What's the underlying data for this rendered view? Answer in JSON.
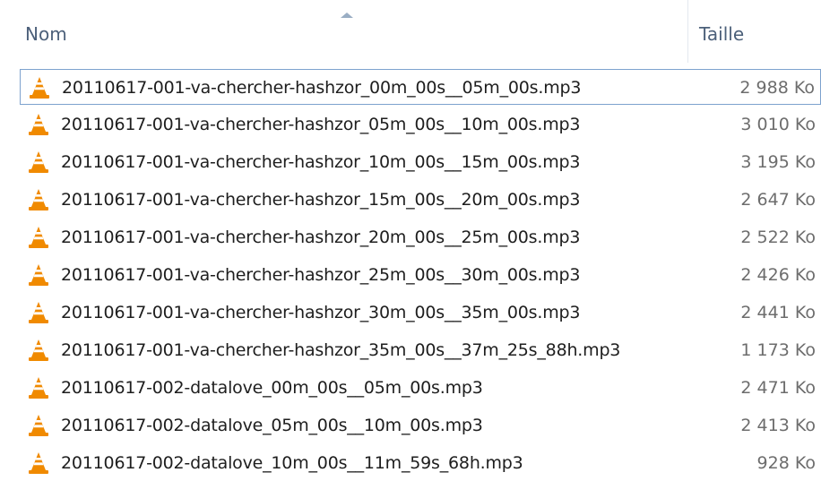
{
  "columns": {
    "name_label": "Nom",
    "size_label": "Taille",
    "sort_column": "name",
    "sort_direction": "ascending"
  },
  "colors": {
    "header_text": "#4c607a",
    "file_text": "#1e1e1e",
    "size_text": "#6d6d6d",
    "focus_border": "#7da2ce",
    "vlc_orange": "#f08a00"
  },
  "file_icon": "vlc-cone-icon",
  "files": [
    {
      "name": "20110617-001-va-chercher-hashzor_00m_00s__05m_00s.mp3",
      "size": "2 988 Ko"
    },
    {
      "name": "20110617-001-va-chercher-hashzor_05m_00s__10m_00s.mp3",
      "size": "3 010 Ko"
    },
    {
      "name": "20110617-001-va-chercher-hashzor_10m_00s__15m_00s.mp3",
      "size": "3 195 Ko"
    },
    {
      "name": "20110617-001-va-chercher-hashzor_15m_00s__20m_00s.mp3",
      "size": "2 647 Ko"
    },
    {
      "name": "20110617-001-va-chercher-hashzor_20m_00s__25m_00s.mp3",
      "size": "2 522 Ko"
    },
    {
      "name": "20110617-001-va-chercher-hashzor_25m_00s__30m_00s.mp3",
      "size": "2 426 Ko"
    },
    {
      "name": "20110617-001-va-chercher-hashzor_30m_00s__35m_00s.mp3",
      "size": "2 441 Ko"
    },
    {
      "name": "20110617-001-va-chercher-hashzor_35m_00s__37m_25s_88h.mp3",
      "size": "1 173 Ko"
    },
    {
      "name": "20110617-002-datalove_00m_00s__05m_00s.mp3",
      "size": "2 471 Ko"
    },
    {
      "name": "20110617-002-datalove_05m_00s__10m_00s.mp3",
      "size": "2 413 Ko"
    },
    {
      "name": "20110617-002-datalove_10m_00s__11m_59s_68h.mp3",
      "size": "928 Ko"
    }
  ]
}
